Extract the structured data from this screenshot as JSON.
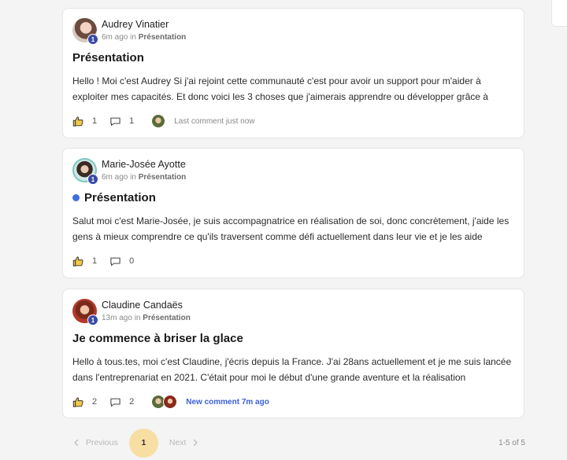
{
  "posts": [
    {
      "author": "Audrey Vinatier",
      "level": "1",
      "time": "6m ago",
      "in_label": "in",
      "space": "Présentation",
      "title": "Présentation",
      "unread": false,
      "body": "Hello ! Moi c'est Audrey Si j'ai rejoint cette communauté c'est pour avoir un support pour m'aider à exploiter mes capacités. Et donc voici les 3 choses que j'aimerais apprendre ou développer grâce à",
      "likes": "1",
      "comments": "1",
      "last_comment": "Last comment just now"
    },
    {
      "author": "Marie-Josée Ayotte",
      "level": "1",
      "time": "6m ago",
      "in_label": "in",
      "space": "Présentation",
      "title": "Présentation",
      "unread": true,
      "body": "Salut moi c'est Marie-Josée, je suis accompagnatrice en réalisation de soi, donc concrètement, j'aide les gens à mieux comprendre ce qu'ils traversent comme défi actuellement dans leur vie et je les aide",
      "likes": "1",
      "comments": "0"
    },
    {
      "author": "Claudine Candaës",
      "level": "1",
      "time": "13m ago",
      "in_label": "in",
      "space": "Présentation",
      "title": "Je commence à briser la glace",
      "unread": false,
      "body": "Hello à tous.tes, moi c'est Claudine, j'écris depuis la France. J'ai 28ans actuellement et je me suis lancée dans l'entreprenariat en 2021. C'était pour moi le début d'une grande aventure et la réalisation",
      "likes": "2",
      "comments": "2",
      "new_comment": "New comment 7m ago"
    }
  ],
  "pagination": {
    "previous": "Previous",
    "current": "1",
    "next": "Next",
    "count": "1-5 of 5"
  },
  "colors": {
    "accent_blue": "#3a5fd8",
    "unread_dot": "#3f6fe0",
    "page_highlight": "#f7dfa3",
    "level_badge": "#3a4aa8"
  },
  "icons": [
    "thumbs-up-icon",
    "comment-icon",
    "chevron-left-icon",
    "chevron-right-icon"
  ]
}
